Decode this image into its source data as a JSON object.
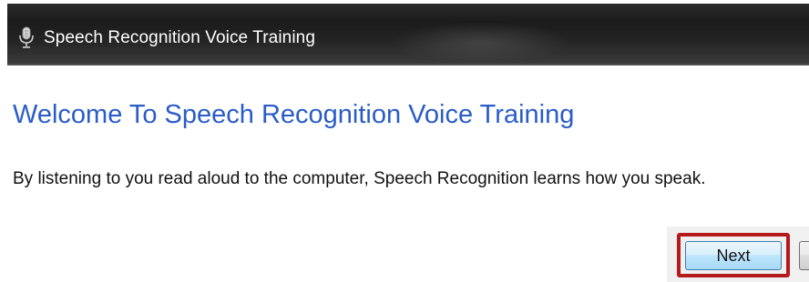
{
  "window": {
    "title": "Speech Recognition Voice Training",
    "icon": "microphone-icon"
  },
  "page": {
    "heading": "Welcome To Speech Recognition Voice Training",
    "description": "By listening to you read aloud to the computer, Speech Recognition learns how you speak."
  },
  "buttons": {
    "next_label": "Next"
  },
  "colors": {
    "heading": "#2a5cc8",
    "highlight": "#b51a1a",
    "titlebar": "#1b1b1b"
  }
}
